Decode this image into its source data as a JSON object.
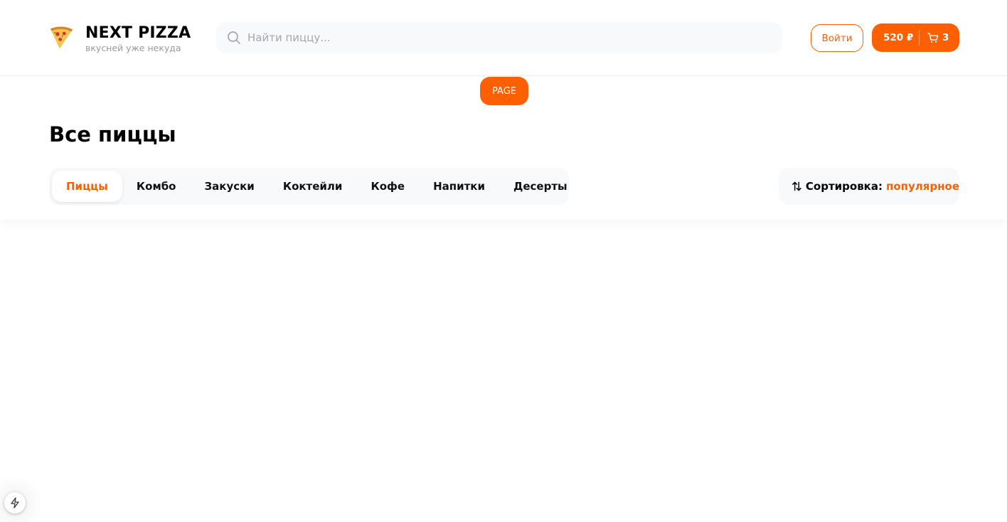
{
  "header": {
    "logo": {
      "title": "NEXT PIZZA",
      "subtitle": "вкусней уже некуда",
      "icon": "pizza-slice-icon"
    },
    "search": {
      "placeholder": "Найти пиццу...",
      "value": "",
      "icon": "search-icon"
    },
    "login_label": "Войти",
    "cart": {
      "price": "520 ₽",
      "count": "3",
      "icon": "shopping-cart-icon"
    }
  },
  "badge": {
    "label": "PAGE"
  },
  "main": {
    "title": "Все пиццы",
    "categories": [
      {
        "label": "Пиццы",
        "active": true
      },
      {
        "label": "Комбо",
        "active": false
      },
      {
        "label": "Закуски",
        "active": false
      },
      {
        "label": "Коктейли",
        "active": false
      },
      {
        "label": "Кофе",
        "active": false
      },
      {
        "label": "Напитки",
        "active": false
      },
      {
        "label": "Десерты",
        "active": false
      }
    ],
    "sort": {
      "label": "Сортировка:",
      "value": "популярное",
      "icon": "sort-arrows-icon"
    }
  },
  "dev_indicator": {
    "icon": "lightning-icon"
  },
  "colors": {
    "accent": "#fe5f00",
    "panel": "#f8f9fa"
  }
}
